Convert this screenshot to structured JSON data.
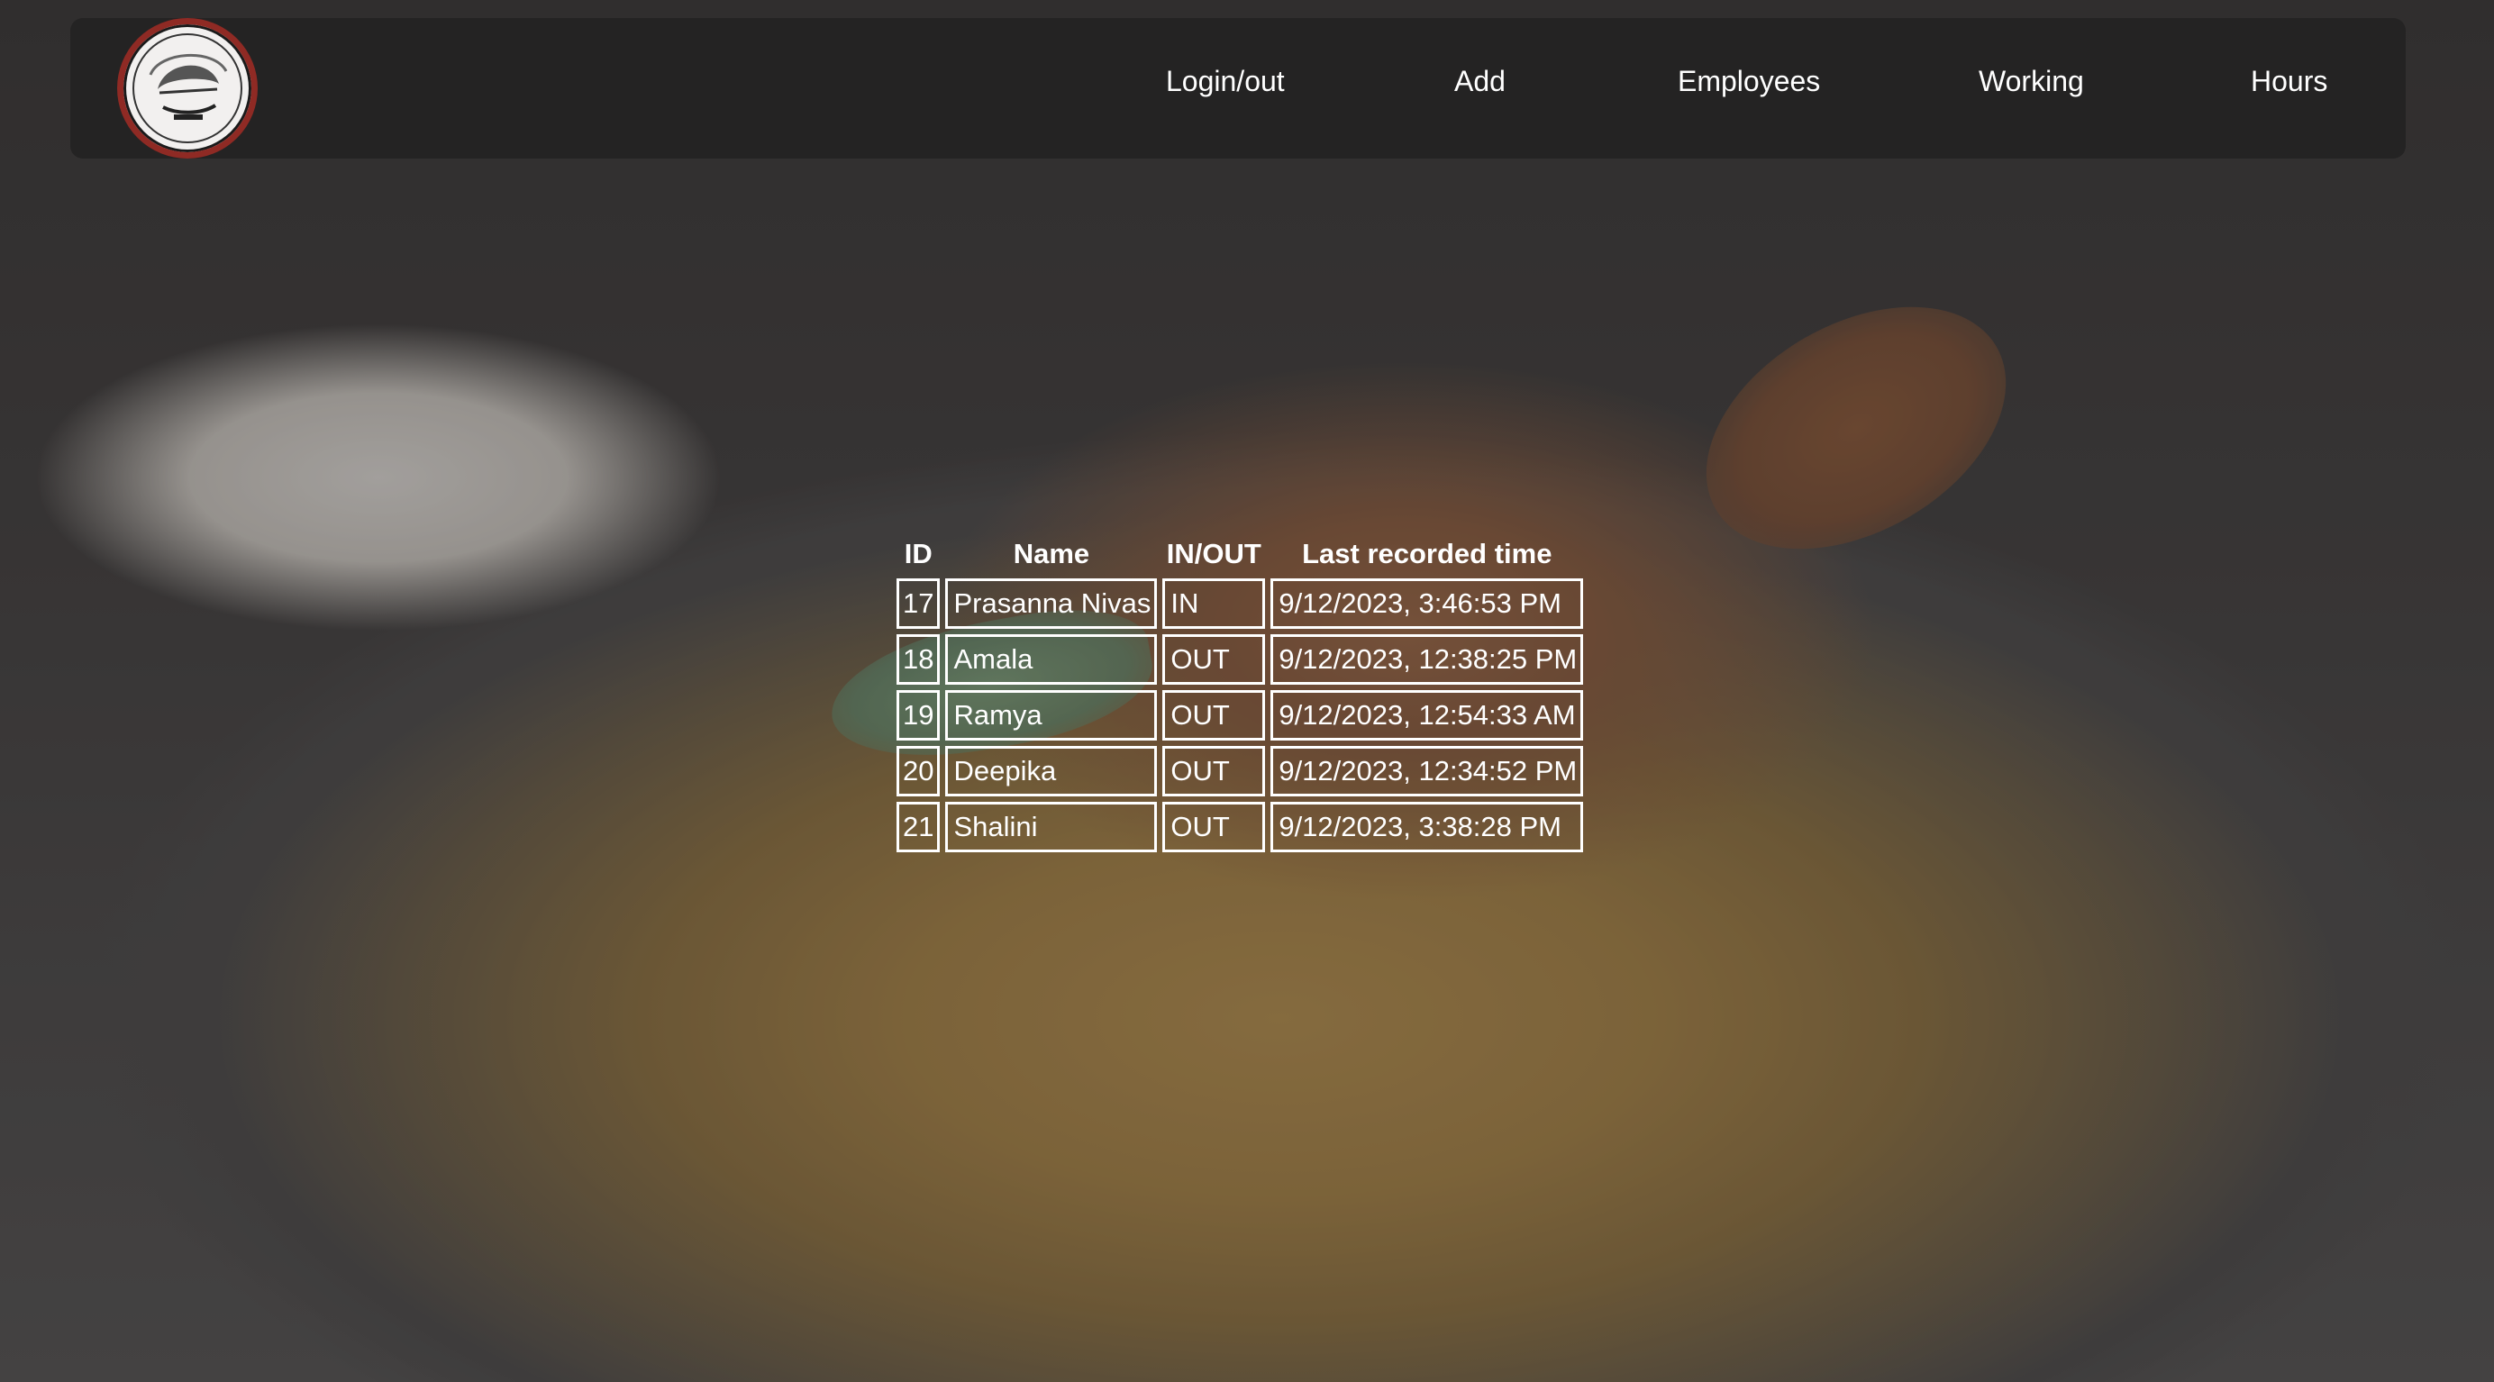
{
  "navbar": {
    "logo_icon": "biryani-brand-logo",
    "links": [
      {
        "label": "Login/out"
      },
      {
        "label": "Add"
      },
      {
        "label": "Employees"
      },
      {
        "label": "Working"
      },
      {
        "label": "Hours"
      }
    ]
  },
  "attendance_table": {
    "headers": {
      "id": "ID",
      "name": "Name",
      "in_out": "IN/OUT",
      "last_time": "Last recorded time"
    },
    "rows": [
      {
        "id": "17",
        "name": "Prasanna Nivas",
        "in_out": "IN",
        "last_time": "9/12/2023, 3:46:53 PM"
      },
      {
        "id": "18",
        "name": "Amala",
        "in_out": "OUT",
        "last_time": "9/12/2023, 12:38:25 PM"
      },
      {
        "id": "19",
        "name": "Ramya",
        "in_out": "OUT",
        "last_time": "9/12/2023, 12:54:33 AM"
      },
      {
        "id": "20",
        "name": "Deepika",
        "in_out": "OUT",
        "last_time": "9/12/2023, 12:34:52 PM"
      },
      {
        "id": "21",
        "name": "Shalini",
        "in_out": "OUT",
        "last_time": "9/12/2023, 3:38:28 PM"
      }
    ]
  },
  "colors": {
    "navbar_bg": "#242323",
    "text": "#ffffff",
    "logo_ring": "#8f2a24"
  }
}
